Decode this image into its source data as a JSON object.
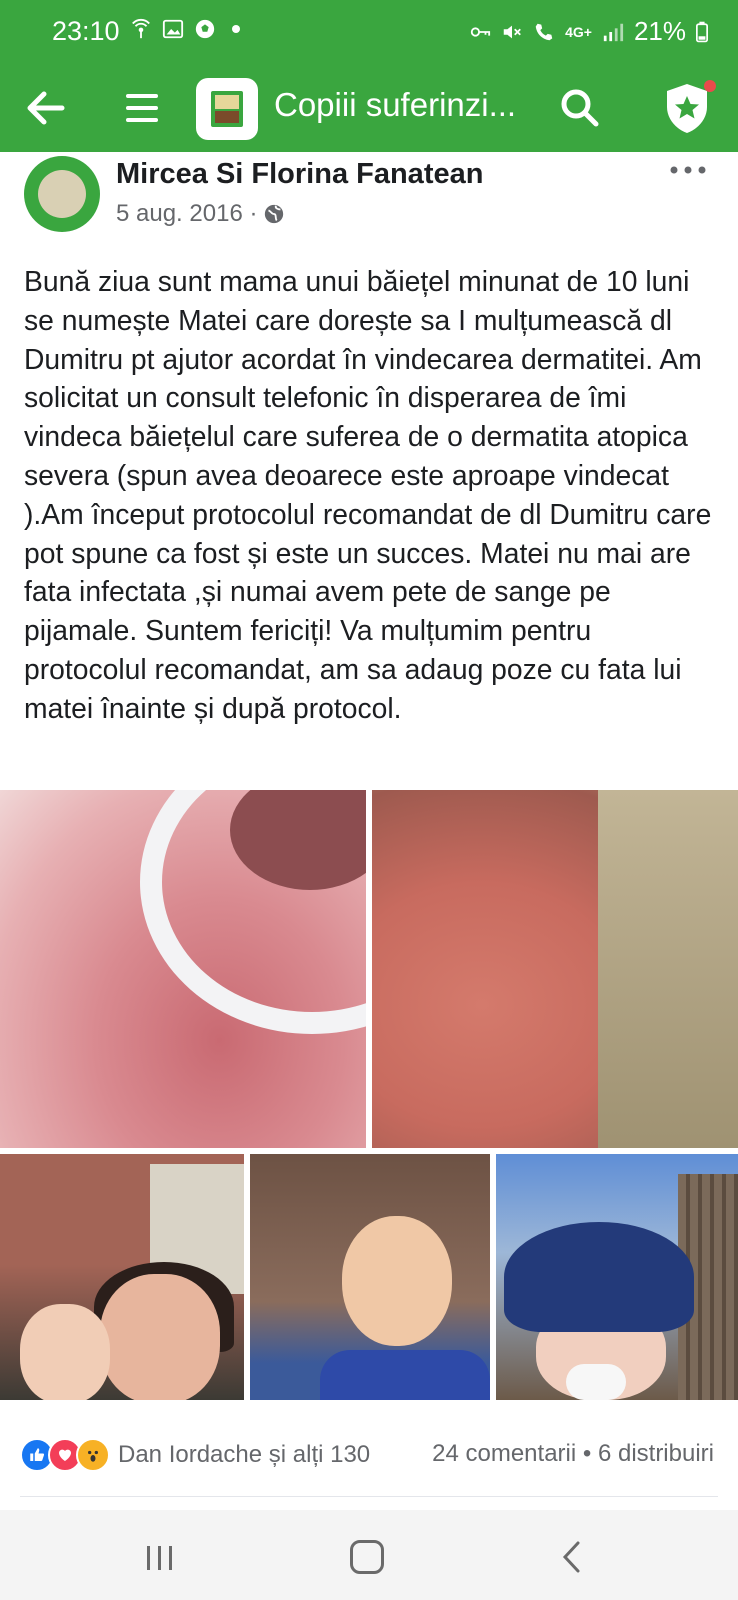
{
  "status_bar": {
    "time": "23:10",
    "network": "4G+",
    "battery": "21%",
    "icons": [
      "wifi-hotspot-icon",
      "gallery-icon",
      "soccer-icon",
      "key-icon",
      "mute-icon",
      "call-icon",
      "signal-icon",
      "battery-icon"
    ]
  },
  "app_bar": {
    "title": "Copiii suferinzi...",
    "icons": [
      "back-arrow-icon",
      "menu-icon",
      "group-thumbnail",
      "search-icon",
      "shield-star-icon"
    ],
    "accent_color": "#3aa63f"
  },
  "post": {
    "author": "Mircea Si Florina Fanatean",
    "date": "5 aug. 2016 ·",
    "privacy_icon": "globe-icon",
    "text": "Bună ziua sunt mama unui băiețel minunat de 10 luni se numește Matei care dorește sa I mulțumească dl Dumitru pt ajutor acordat în vindecarea dermatitei. Am solicitat un consult telefonic în disperarea de îmi vindeca băiețelul care suferea de o dermatita atopica severa  (spun avea deoarece este aproape vindecat ).Am început protocolul recomandat de dl Dumitru care pot spune ca fost și este un succes. Matei nu mai are fata infectata ,și numai avem pete de sange pe pijamale. Suntem fericiți! Va mulțumim pentru protocolul recomandat, am sa adaug poze cu fata lui matei înainte și după protocol."
  },
  "reactions": {
    "names": "Dan Iordache și alți 130",
    "comments": "24 comentarii",
    "separator": "•",
    "shares": "6 distribuiri",
    "icons": [
      "like-icon",
      "love-icon",
      "wow-icon"
    ]
  },
  "nav_bar": {
    "icons": [
      "recent-apps-icon",
      "home-icon",
      "back-icon"
    ]
  }
}
